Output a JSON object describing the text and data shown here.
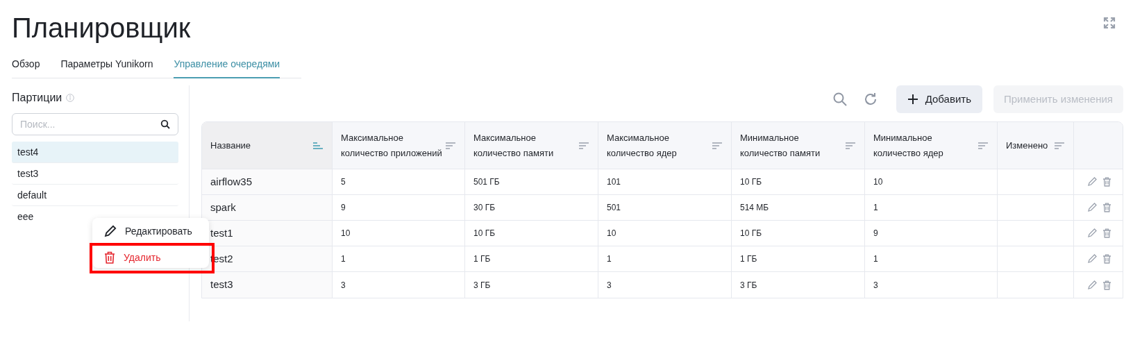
{
  "title": "Планировщик",
  "tabs": [
    {
      "label": "Обзор",
      "selected": false
    },
    {
      "label": "Параметры Yunikorn",
      "selected": false
    },
    {
      "label": "Управление очередями",
      "selected": true
    }
  ],
  "sidebar": {
    "heading": "Партиции",
    "search": {
      "placeholder": "Поиск..."
    },
    "items": [
      {
        "label": "test4",
        "selected": true
      },
      {
        "label": "test3",
        "selected": false
      },
      {
        "label": "default",
        "selected": false
      },
      {
        "label": "eee",
        "selected": false
      }
    ]
  },
  "context_menu": [
    {
      "kind": "edit",
      "label": "Редактировать",
      "highlighted": false
    },
    {
      "kind": "delete",
      "label": "Удалить",
      "highlighted": true
    }
  ],
  "toolbar": {
    "add_button": "Добавить",
    "apply_button": {
      "label": "Применить изменения",
      "disabled": true
    }
  },
  "table": {
    "columns": [
      {
        "label": "Название",
        "sorted": true
      },
      {
        "label": "Максимальное количество приложений",
        "sorted": false
      },
      {
        "label": "Максимальное количество памяти",
        "sorted": false
      },
      {
        "label": "Максимальное количество ядер",
        "sorted": false
      },
      {
        "label": "Минимальное количество памяти",
        "sorted": false
      },
      {
        "label": "Минимальное количество ядер",
        "sorted": false
      },
      {
        "label": "Изменено",
        "sorted": false
      }
    ],
    "rows": [
      [
        "airflow35",
        "5",
        "501 ГБ",
        "101",
        "10 ГБ",
        "10"
      ],
      [
        "spark",
        "9",
        "30 ГБ",
        "501",
        "514 МБ",
        "1"
      ],
      [
        "test1",
        "10",
        "10 ГБ",
        "10",
        "10 ГБ",
        "9"
      ],
      [
        "test2",
        "1",
        "1 ГБ",
        "1",
        "1 ГБ",
        "1"
      ],
      [
        "test3",
        "3",
        "3 ГБ",
        "3",
        "3 ГБ",
        "3"
      ]
    ]
  }
}
